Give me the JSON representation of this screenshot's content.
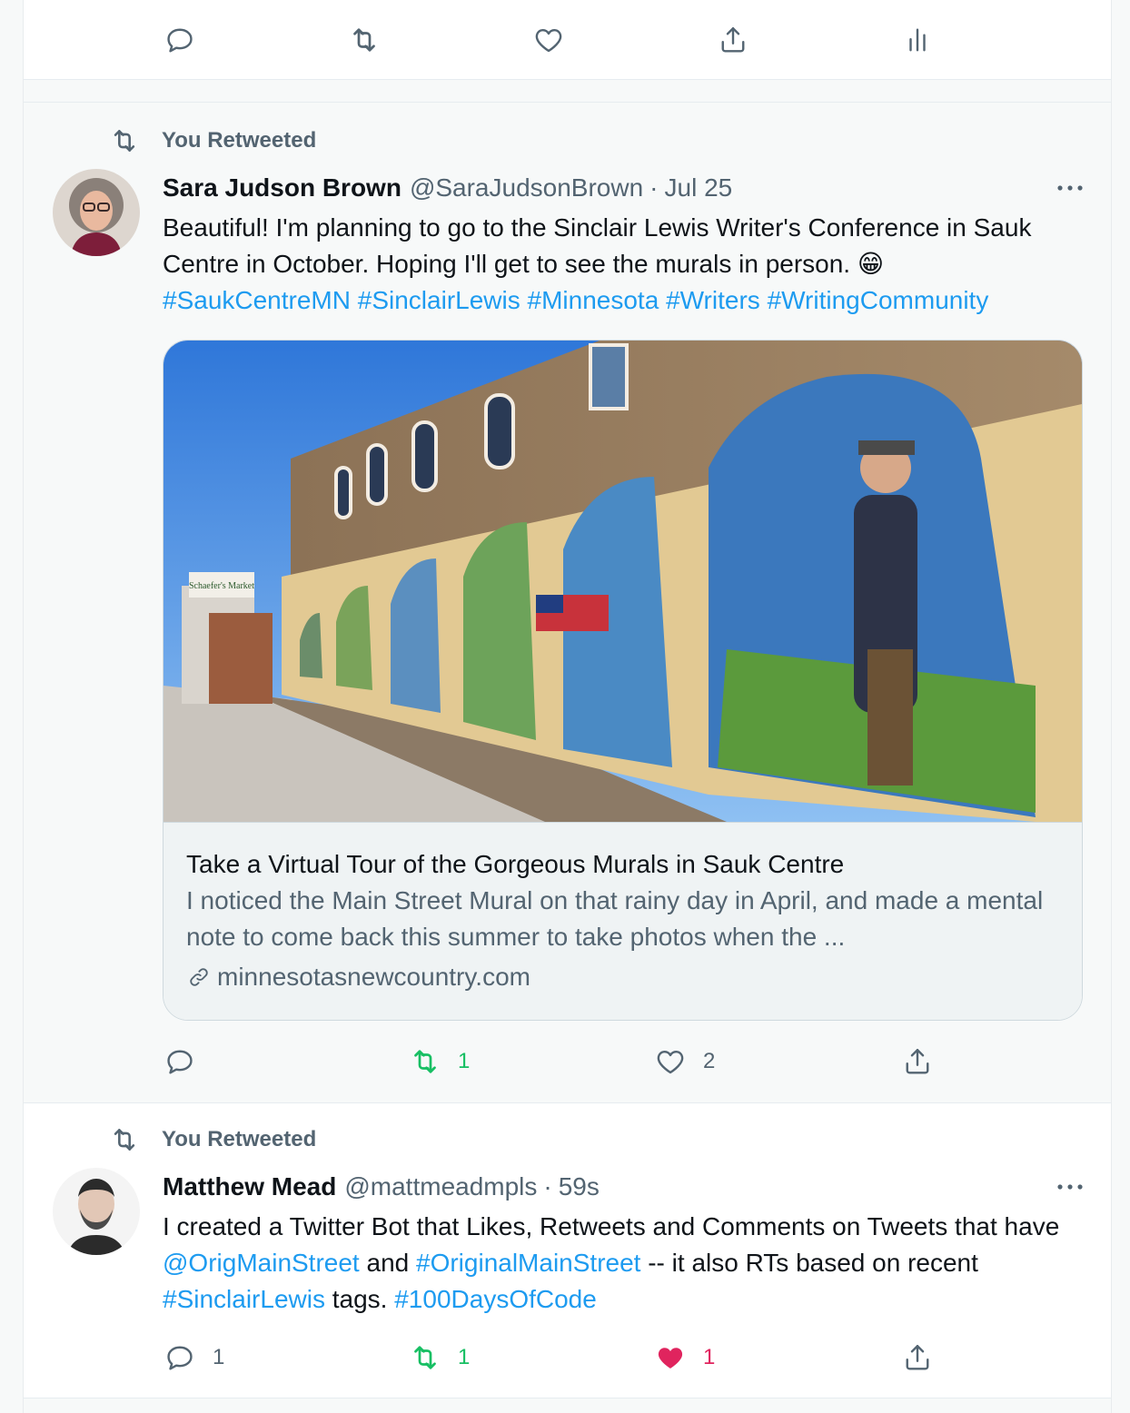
{
  "top_actions": {
    "reply": {
      "icon": "reply-icon"
    },
    "retweet": {
      "icon": "retweet-icon"
    },
    "like": {
      "icon": "heart-icon"
    },
    "share": {
      "icon": "share-icon"
    },
    "analytics": {
      "icon": "analytics-icon"
    }
  },
  "tweets": [
    {
      "retweet_label": "You Retweeted",
      "name": "Sara Judson Brown",
      "handle": "@SaraJudsonBrown",
      "dot": "·",
      "time": "Jul 25",
      "text_main": "Beautiful! I'm planning to go to the Sinclair Lewis Writer's Conference in Sauk Centre in October. Hoping I'll get to see the murals in person.",
      "emoji": "😁",
      "hashtags": [
        "#SaukCentreMN",
        "#SinclairLewis",
        "#Minnesota",
        "#Writers",
        "#WritingCommunity"
      ],
      "link_card": {
        "title": "Take a Virtual Tour of the Gorgeous Murals in Sauk Centre",
        "description": "I noticed the Main Street Mural on that rainy day in April, and made a mental note to come back this summer to take photos when the ...",
        "domain": "minnesotasnewcountry.com",
        "image_sign": "Schaefer's Market"
      },
      "counts": {
        "reply": "",
        "retweet": "1",
        "like": "2"
      },
      "retweeted": true,
      "liked": false
    },
    {
      "retweet_label": "You Retweeted",
      "name": "Matthew Mead",
      "handle": "@mattmeadmpls",
      "dot": "·",
      "time": "59s",
      "text_part1": "I created a Twitter Bot that Likes, Retweets and Comments on Tweets that have",
      "mention1": "@OrigMainStreet",
      "text_part2": "and",
      "hashtag1": "#OriginalMainStreet",
      "text_part3": "-- it also RTs based on recent",
      "hashtag2": "#SinclairLewis",
      "text_part4": "tags.",
      "hashtag3": "#100DaysOfCode",
      "counts": {
        "reply": "1",
        "retweet": "1",
        "like": "1"
      },
      "retweeted": true,
      "liked": true
    }
  ],
  "colors": {
    "link": "#1d9bf0",
    "retweet_active": "#17bf63",
    "like_active": "#e0245e",
    "muted": "#536471"
  }
}
